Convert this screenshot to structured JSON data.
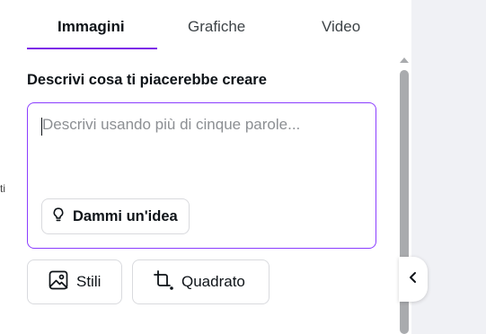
{
  "tabs": [
    {
      "label": "Immagini",
      "active": true
    },
    {
      "label": "Grafiche",
      "active": false
    },
    {
      "label": "Video",
      "active": false
    }
  ],
  "edge_text": "ti",
  "prompt": {
    "label": "Descrivi cosa ti piacerebbe creare",
    "placeholder": "Descrivi usando più di cinque parole...",
    "value": "",
    "idea_button": "Dammi un'idea"
  },
  "options": {
    "styles_label": "Stili",
    "format_label": "Quadrato"
  },
  "icons": {
    "idea": "lightbulb-icon",
    "styles": "image-icon",
    "format": "crop-icon",
    "scroll_up": "triangle-up-icon",
    "collapse": "chevron-left-icon"
  },
  "colors": {
    "accent": "#7d2ae8",
    "input_border": "#8b3dff",
    "scrollbar": "#a9abae",
    "canvas_bg": "#f0f1f5"
  }
}
